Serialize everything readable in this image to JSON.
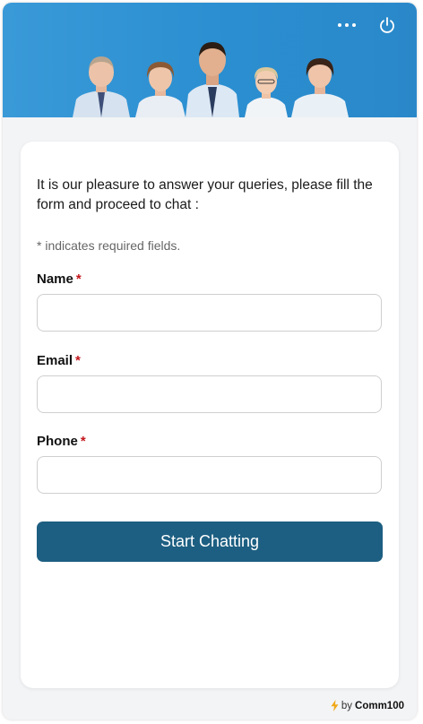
{
  "header": {
    "more_icon": "more-horizontal-icon",
    "power_icon": "power-icon",
    "banner": "team-photo"
  },
  "form": {
    "intro": "It is our pleasure to answer your queries, please fill the form and proceed to chat :",
    "required_note": "* indicates required fields.",
    "required_marker": "*",
    "fields": [
      {
        "label": "Name",
        "value": "",
        "placeholder": ""
      },
      {
        "label": "Email",
        "value": "",
        "placeholder": ""
      },
      {
        "label": "Phone",
        "value": "",
        "placeholder": ""
      }
    ],
    "submit_label": "Start Chatting"
  },
  "footer": {
    "by": "by",
    "brand": "Comm100"
  },
  "colors": {
    "header_bg": "#2b8fd1",
    "button_bg": "#1d5f82",
    "required_star": "#c4161c",
    "page_bg": "#f3f4f6"
  }
}
